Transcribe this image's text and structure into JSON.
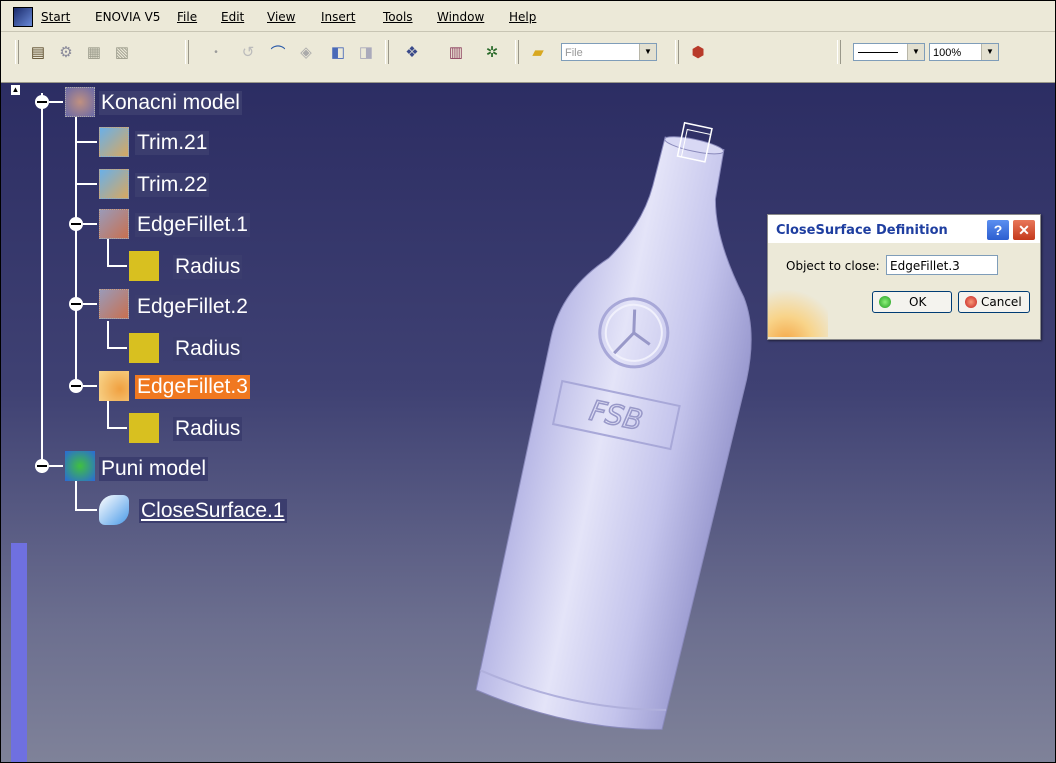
{
  "menubar": {
    "start": "Start",
    "items": [
      "ENOVIA V5",
      "File",
      "Edit",
      "View",
      "Insert",
      "Tools",
      "Window",
      "Help"
    ]
  },
  "toolbar": {
    "file_combo": "File",
    "zoom_combo": "100%",
    "icons": [
      "properties-icon",
      "catalog-icon",
      "tools-icon",
      "publication-icon",
      "undo-icon",
      "redo-icon",
      "arc-icon",
      "sketch-icon",
      "view-icon",
      "view-alt-icon",
      "apply-material-icon",
      "table-icon",
      "analysis-icon",
      "open-folder-icon",
      "filter-icon"
    ]
  },
  "tree": {
    "root": "Konacni model",
    "items": [
      {
        "label": "Trim.21"
      },
      {
        "label": "Trim.22"
      },
      {
        "label": "EdgeFillet.1"
      },
      {
        "label": "Radius"
      },
      {
        "label": "EdgeFillet.2"
      },
      {
        "label": "Radius"
      },
      {
        "label": "EdgeFillet.3"
      },
      {
        "label": "Radius"
      }
    ],
    "root2": "Puni model",
    "root2_child": "CloseSurface.1"
  },
  "dialog": {
    "title": "CloseSurface Definition",
    "field_label": "Object to close:",
    "field_value": "EdgeFillet.3",
    "ok_label": "OK",
    "cancel_label": "Cancel",
    "help_glyph": "?",
    "close_glyph": "✕"
  },
  "model": {
    "emboss_text": "FSB"
  },
  "colors": {
    "selected": "#f07820",
    "background_top": "#2c2d63",
    "bottle": "#c9c9f0"
  }
}
